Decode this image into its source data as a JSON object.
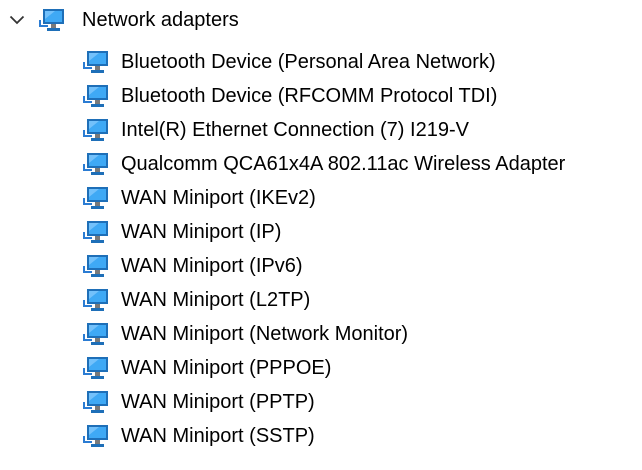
{
  "category": {
    "label": "Network adapters",
    "expanded": true,
    "chevron_icon": "chevron-down-icon",
    "icon": "network-adapter-icon"
  },
  "devices": [
    {
      "label": "Bluetooth Device (Personal Area Network)",
      "icon": "network-adapter-icon"
    },
    {
      "label": "Bluetooth Device (RFCOMM Protocol TDI)",
      "icon": "network-adapter-icon"
    },
    {
      "label": "Intel(R) Ethernet Connection (7) I219-V",
      "icon": "network-adapter-icon"
    },
    {
      "label": "Qualcomm QCA61x4A 802.11ac Wireless Adapter",
      "icon": "network-adapter-icon"
    },
    {
      "label": "WAN Miniport (IKEv2)",
      "icon": "network-adapter-icon"
    },
    {
      "label": "WAN Miniport (IP)",
      "icon": "network-adapter-icon"
    },
    {
      "label": "WAN Miniport (IPv6)",
      "icon": "network-adapter-icon"
    },
    {
      "label": "WAN Miniport (L2TP)",
      "icon": "network-adapter-icon"
    },
    {
      "label": "WAN Miniport (Network Monitor)",
      "icon": "network-adapter-icon"
    },
    {
      "label": "WAN Miniport (PPPOE)",
      "icon": "network-adapter-icon"
    },
    {
      "label": "WAN Miniport (PPTP)",
      "icon": "network-adapter-icon"
    },
    {
      "label": "WAN Miniport (SSTP)",
      "icon": "network-adapter-icon"
    }
  ],
  "colors": {
    "monitor_frame": "#1e6fb8",
    "monitor_screen": "#3fa9f5",
    "monitor_stand": "#7a7a7a",
    "network_line": "#2b7cd3",
    "chevron": "#333333"
  }
}
